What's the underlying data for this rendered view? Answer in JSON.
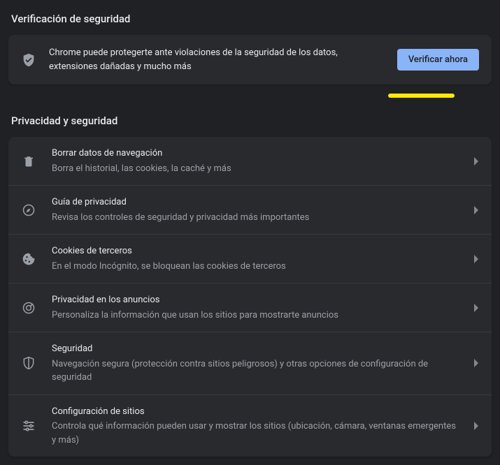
{
  "safety_check": {
    "heading": "Verificación de seguridad",
    "message": "Chrome puede protegerte ante violaciones de la seguridad de los datos, extensiones dañadas y mucho más",
    "button": "Verificar ahora"
  },
  "privacy": {
    "heading": "Privacidad y seguridad",
    "items": [
      {
        "icon": "trash-icon",
        "title": "Borrar datos de navegación",
        "subtitle": "Borra el historial, las cookies, la caché y más"
      },
      {
        "icon": "compass-icon",
        "title": "Guía de privacidad",
        "subtitle": "Revisa los controles de seguridad y privacidad más importantes"
      },
      {
        "icon": "cookie-icon",
        "title": "Cookies de terceros",
        "subtitle": "En el modo Incógnito, se bloquean las cookies de terceros"
      },
      {
        "icon": "ads-icon",
        "title": "Privacidad en los anuncios",
        "subtitle": "Personaliza la información que usan los sitios para mostrarte anuncios"
      },
      {
        "icon": "security-shield-icon",
        "title": "Seguridad",
        "subtitle": "Navegación segura (protección contra sitios peligrosos) y otras opciones de configuración de seguridad"
      },
      {
        "icon": "tune-icon",
        "title": "Configuración de sitios",
        "subtitle": "Controla qué información pueden usar y mostrar los sitios (ubicación, cámara, ventanas emergentes y más)"
      }
    ]
  }
}
